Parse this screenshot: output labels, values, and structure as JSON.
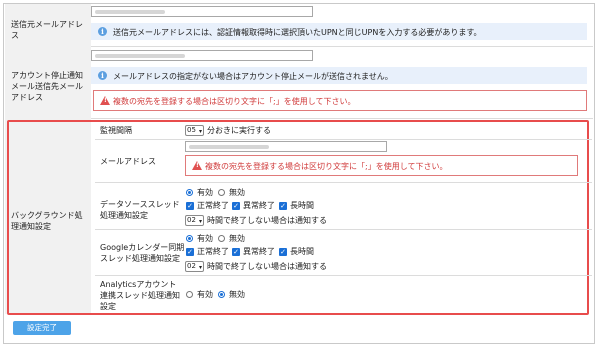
{
  "sender": {
    "label": "送信元メールアドレス",
    "info": "送信元メールアドレスには、認証情報取得時に選択頂いたUPNと同じUPNを入力する必要があります。"
  },
  "stop_notify": {
    "label": "アカウント停止通知メール送信先メールアドレス",
    "info": "メールアドレスの指定がない場合はアカウント停止メールが送信されません。",
    "warn": "複数の宛先を登録する場合は区切り文字に「;」を使用して下さい。"
  },
  "background": {
    "label": "バックグラウンド処理通知設定",
    "interval": {
      "label": "監視間隔",
      "value": "05",
      "suffix": "分おきに実行する"
    },
    "mail": {
      "label": "メールアドレス",
      "warn": "複数の宛先を登録する場合は区切り文字に「;」を使用して下さい。"
    },
    "datasource": {
      "label": "データソーススレッド処理通知設定",
      "enabled": "有効",
      "disabled": "無効",
      "normal": "正常終了",
      "abnormal": "異常終了",
      "long": "長時間",
      "hours": "02",
      "hours_suffix": "時間で終了しない場合は通知する"
    },
    "google": {
      "label": "Googleカレンダー同期スレッド処理通知設定",
      "enabled": "有効",
      "disabled": "無効",
      "normal": "正常終了",
      "abnormal": "異常終了",
      "long": "長時間",
      "hours": "02",
      "hours_suffix": "時間で終了しない場合は通知する"
    },
    "analytics": {
      "label": "Analyticsアカウント連携スレッド処理通知設定",
      "enabled": "有効",
      "disabled": "無効"
    }
  },
  "submit": "設定完了",
  "colors": {
    "accent": "#1a6fd6",
    "warn": "#e84c4c",
    "info_bg": "#e8f0fb",
    "button": "#4da3e8"
  }
}
